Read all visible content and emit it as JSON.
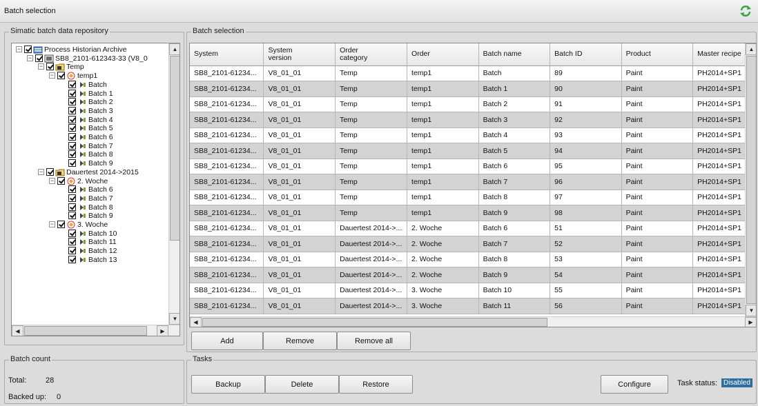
{
  "window": {
    "title": "Batch selection"
  },
  "colors": {
    "status_badge_bg": "#2d6e9e",
    "row_alt": "#d3d3d3",
    "refresh_green": "#3ca14a"
  },
  "repo": {
    "label": "Simatic batch data repository",
    "tree": [
      {
        "level": 0,
        "exp": "-",
        "icon": "archive-icon",
        "label": "Process Historian Archive"
      },
      {
        "level": 1,
        "exp": "-",
        "icon": "system-icon",
        "label": "SB8_2101-612343-33 (V8_0"
      },
      {
        "level": 2,
        "exp": "-",
        "icon": "folder-icon",
        "label": "Temp"
      },
      {
        "level": 3,
        "exp": "-",
        "icon": "order-icon",
        "label": "temp1"
      },
      {
        "level": 4,
        "exp": "",
        "icon": "batch-icon",
        "label": "Batch"
      },
      {
        "level": 4,
        "exp": "",
        "icon": "batch-icon",
        "label": "Batch 1"
      },
      {
        "level": 4,
        "exp": "",
        "icon": "batch-icon",
        "label": "Batch 2"
      },
      {
        "level": 4,
        "exp": "",
        "icon": "batch-icon",
        "label": "Batch 3"
      },
      {
        "level": 4,
        "exp": "",
        "icon": "batch-icon",
        "label": "Batch 4"
      },
      {
        "level": 4,
        "exp": "",
        "icon": "batch-icon",
        "label": "Batch 5"
      },
      {
        "level": 4,
        "exp": "",
        "icon": "batch-icon",
        "label": "Batch 6"
      },
      {
        "level": 4,
        "exp": "",
        "icon": "batch-icon",
        "label": "Batch 7"
      },
      {
        "level": 4,
        "exp": "",
        "icon": "batch-icon",
        "label": "Batch 8"
      },
      {
        "level": 4,
        "exp": "",
        "icon": "batch-icon",
        "label": "Batch 9"
      },
      {
        "level": 2,
        "exp": "-",
        "icon": "folder-icon",
        "label": "Dauertest 2014->2015"
      },
      {
        "level": 3,
        "exp": "-",
        "icon": "order-icon",
        "label": "2. Woche"
      },
      {
        "level": 4,
        "exp": "",
        "icon": "batch-icon",
        "label": "Batch 6"
      },
      {
        "level": 4,
        "exp": "",
        "icon": "batch-icon",
        "label": "Batch 7"
      },
      {
        "level": 4,
        "exp": "",
        "icon": "batch-icon",
        "label": "Batch 8"
      },
      {
        "level": 4,
        "exp": "",
        "icon": "batch-icon",
        "label": "Batch 9"
      },
      {
        "level": 3,
        "exp": "-",
        "icon": "order-icon",
        "label": "3. Woche"
      },
      {
        "level": 4,
        "exp": "",
        "icon": "batch-icon",
        "label": "Batch 10"
      },
      {
        "level": 4,
        "exp": "",
        "icon": "batch-icon",
        "label": "Batch 11"
      },
      {
        "level": 4,
        "exp": "",
        "icon": "batch-icon",
        "label": "Batch 12"
      },
      {
        "level": 4,
        "exp": "",
        "icon": "batch-icon",
        "label": "Batch 13"
      }
    ]
  },
  "selection": {
    "label": "Batch selection",
    "columns": [
      "System",
      "System\nversion",
      "Order\ncategory",
      "Order",
      "Batch name",
      "Batch ID",
      "Product",
      "Master recipe"
    ],
    "rows": [
      [
        "SB8_2101-61234...",
        "V8_01_01",
        "Temp",
        "temp1",
        "Batch",
        "89",
        "Paint",
        "PH2014+SP1"
      ],
      [
        "SB8_2101-61234...",
        "V8_01_01",
        "Temp",
        "temp1",
        "Batch 1",
        "90",
        "Paint",
        "PH2014+SP1"
      ],
      [
        "SB8_2101-61234...",
        "V8_01_01",
        "Temp",
        "temp1",
        "Batch 2",
        "91",
        "Paint",
        "PH2014+SP1"
      ],
      [
        "SB8_2101-61234...",
        "V8_01_01",
        "Temp",
        "temp1",
        "Batch 3",
        "92",
        "Paint",
        "PH2014+SP1"
      ],
      [
        "SB8_2101-61234...",
        "V8_01_01",
        "Temp",
        "temp1",
        "Batch 4",
        "93",
        "Paint",
        "PH2014+SP1"
      ],
      [
        "SB8_2101-61234...",
        "V8_01_01",
        "Temp",
        "temp1",
        "Batch 5",
        "94",
        "Paint",
        "PH2014+SP1"
      ],
      [
        "SB8_2101-61234...",
        "V8_01_01",
        "Temp",
        "temp1",
        "Batch 6",
        "95",
        "Paint",
        "PH2014+SP1"
      ],
      [
        "SB8_2101-61234...",
        "V8_01_01",
        "Temp",
        "temp1",
        "Batch 7",
        "96",
        "Paint",
        "PH2014+SP1"
      ],
      [
        "SB8_2101-61234...",
        "V8_01_01",
        "Temp",
        "temp1",
        "Batch 8",
        "97",
        "Paint",
        "PH2014+SP1"
      ],
      [
        "SB8_2101-61234...",
        "V8_01_01",
        "Temp",
        "temp1",
        "Batch 9",
        "98",
        "Paint",
        "PH2014+SP1"
      ],
      [
        "SB8_2101-61234...",
        "V8_01_01",
        "Dauertest 2014->...",
        "2. Woche",
        "Batch 6",
        "51",
        "Paint",
        "PH2014+SP1"
      ],
      [
        "SB8_2101-61234...",
        "V8_01_01",
        "Dauertest 2014->...",
        "2. Woche",
        "Batch 7",
        "52",
        "Paint",
        "PH2014+SP1"
      ],
      [
        "SB8_2101-61234...",
        "V8_01_01",
        "Dauertest 2014->...",
        "2. Woche",
        "Batch 8",
        "53",
        "Paint",
        "PH2014+SP1"
      ],
      [
        "SB8_2101-61234...",
        "V8_01_01",
        "Dauertest 2014->...",
        "2. Woche",
        "Batch 9",
        "54",
        "Paint",
        "PH2014+SP1"
      ],
      [
        "SB8_2101-61234...",
        "V8_01_01",
        "Dauertest 2014->...",
        "3. Woche",
        "Batch 10",
        "55",
        "Paint",
        "PH2014+SP1"
      ],
      [
        "SB8_2101-61234...",
        "V8_01_01",
        "Dauertest 2014->...",
        "3. Woche",
        "Batch 11",
        "56",
        "Paint",
        "PH2014+SP1"
      ]
    ],
    "add_label": "Add",
    "remove_label": "Remove",
    "remove_all_label": "Remove all"
  },
  "batch_count": {
    "label": "Batch count",
    "total_label": "Total:",
    "total_value": "28",
    "backed_up_label": "Backed up:",
    "backed_up_value": "0"
  },
  "tasks": {
    "label": "Tasks",
    "backup_label": "Backup",
    "delete_label": "Delete",
    "restore_label": "Restore",
    "configure_label": "Configure",
    "task_status_label": "Task status:",
    "task_status_value": "Disabled"
  }
}
